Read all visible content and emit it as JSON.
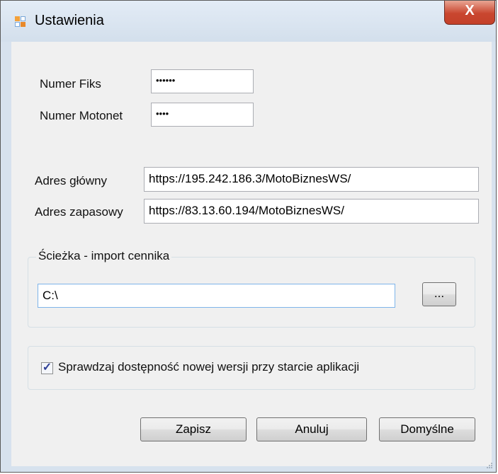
{
  "window": {
    "title": "Ustawienia",
    "close_glyph": "X"
  },
  "fields": {
    "numer_fiks": {
      "label": "Numer Fiks",
      "value": "••••••"
    },
    "numer_motonet": {
      "label": "Numer Motonet",
      "value": "••••"
    },
    "adres_glowny": {
      "label": "Adres główny",
      "value": "https://195.242.186.3/MotoBiznesWS/"
    },
    "adres_zapasowy": {
      "label": "Adres zapasowy",
      "value": "https://83.13.60.194/MotoBiznesWS/"
    }
  },
  "import": {
    "group_title": "Ścieżka - import cennika",
    "path_value": "C:\\",
    "browse_label": "..."
  },
  "update_check": {
    "label": "Sprawdzaj dostępność nowej wersji przy starcie aplikacji",
    "checked": true,
    "check_glyph": "✓"
  },
  "buttons": {
    "save": "Zapisz",
    "cancel": "Anuluj",
    "defaults": "Domyślne"
  },
  "colors": {
    "frame": "#d7e2ee",
    "client": "#f0f0f0",
    "close_button": "#c9462f",
    "checkmark": "#2f3f96"
  }
}
